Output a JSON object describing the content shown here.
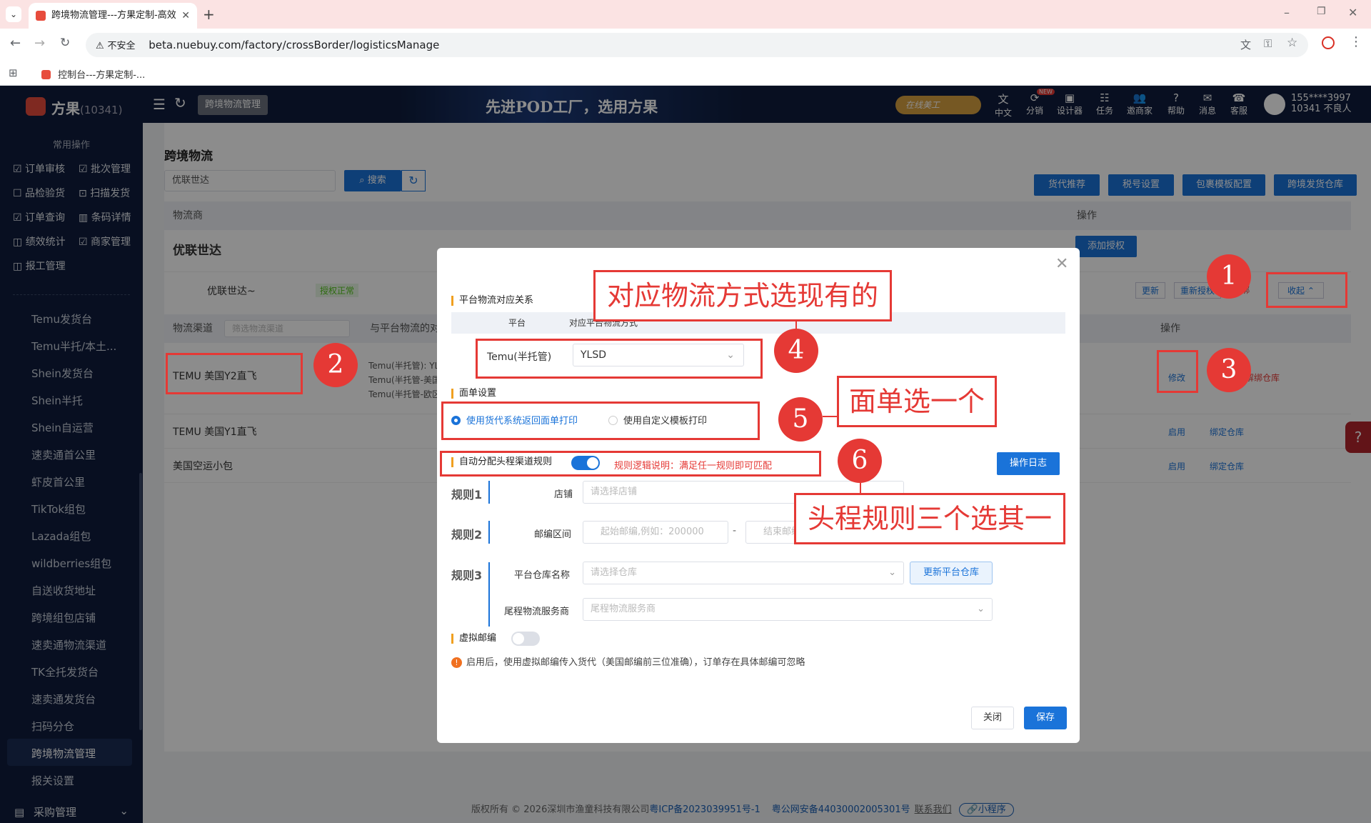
{
  "browser": {
    "tab_title": "跨境物流管理---方果定制-高效",
    "new_tab": "+",
    "url": "beta.nuebuy.com/factory/crossBorder/logisticsManage",
    "not_secure": "不安全",
    "bookmark": "控制台---方果定制-..."
  },
  "header": {
    "logo": "方果",
    "logo_id": "(10341)",
    "breadcrumb": "跨境物流管理",
    "slogan": "先进POD工厂，选用方果",
    "online_badge": "在线美工",
    "icons": [
      {
        "label": "中文",
        "icon": "translate-icon"
      },
      {
        "label": "分销",
        "icon": "share-icon",
        "badge": "NEW"
      },
      {
        "label": "设计器",
        "icon": "image-icon"
      },
      {
        "label": "任务",
        "icon": "task-icon"
      },
      {
        "label": "邀商家",
        "icon": "users-icon"
      },
      {
        "label": "帮助",
        "icon": "help-icon"
      },
      {
        "label": "消息",
        "icon": "message-icon"
      },
      {
        "label": "客服",
        "icon": "service-icon"
      }
    ],
    "user_phone": "155****3997",
    "user_name": "10341 不良人"
  },
  "sidebar": {
    "common_title": "常用操作",
    "quick": [
      [
        "订单审核",
        "批次管理"
      ],
      [
        "品检验货",
        "扫描发货"
      ],
      [
        "订单查询",
        "条码详情"
      ],
      [
        "绩效统计",
        "商家管理"
      ],
      [
        "报工管理",
        ""
      ]
    ],
    "items": [
      "Temu发货台",
      "Temu半托/本土...",
      "Shein发货台",
      "Shein半托",
      "Shein自运营",
      "速卖通首公里",
      "虾皮首公里",
      "TikTok组包",
      "Lazada组包",
      "wildberries组包",
      "自送收货地址",
      "跨境组包店铺",
      "速卖通物流渠道",
      "TK全托发货台",
      "速卖通发货台",
      "扫码分仓",
      "跨境物流管理",
      "报关设置"
    ],
    "active": "跨境物流管理",
    "bottom": "采购管理"
  },
  "page": {
    "title": "跨境物流",
    "search_value": "优联世达",
    "search_btn": "搜索",
    "right_btns": [
      "货代推荐",
      "税号设置",
      "包裹模板配置",
      "跨境发货仓库"
    ],
    "col_provider": "物流商",
    "col_ops": "操作",
    "provider": "优联世达",
    "add_auth": "添加授权",
    "account": "优联世达~",
    "auth_status": "授权正常",
    "account_ops": [
      "更新",
      "重新授权",
      "解绑",
      "收起"
    ],
    "channel_col": "物流渠道",
    "channel_filter": "筛选物流渠道",
    "mapping_col": "与平台物流的对",
    "channels": [
      {
        "name": "TEMU 美国Y2直飞",
        "mapping": [
          "Temu(半托管): YL",
          "Temu(半托管-美国",
          "Temu(半托管-欧区"
        ],
        "ops": [
          "修改",
          "解绑仓库"
        ]
      },
      {
        "name": "TEMU 美国Y1直飞",
        "mapping": [],
        "ops": [
          "启用",
          "绑定仓库"
        ]
      },
      {
        "name": "美国空运小包",
        "mapping": [],
        "ops": [
          "启用",
          "绑定仓库"
        ]
      }
    ],
    "footer": "版权所有 © 2026深圳市渔童科技有限公司",
    "footer_icp": "粤ICP备2023039951号-1",
    "footer_police": "粤公网安备44030002005301号",
    "footer_contact": "联系我们",
    "footer_mini": "小程序"
  },
  "modal": {
    "sec_mapping": "平台物流对应关系",
    "col_platform": "平台",
    "col_method": "对应平台物流方式",
    "platform": "Temu(半托管)",
    "method": "YLSD",
    "sec_label": "面单设置",
    "opt1": "使用货代系统返回面单打印",
    "opt2": "使用自定义模板打印",
    "sec_auto": "自动分配头程渠道规则",
    "auto_on": true,
    "rule_hint": "规则逻辑说明：满足任一规则即可匹配",
    "log_btn": "操作日志",
    "rule1": "规则1",
    "shop_label": "店铺",
    "shop_ph": "请选择店铺",
    "rule2": "规则2",
    "zip_label": "邮编区间",
    "zip_start_ph": "起始邮编,例如：200000",
    "zip_end_ph": "结束邮编,例如：299999",
    "dash": "-",
    "rule3": "规则3",
    "wh_label": "平台仓库名称",
    "wh_ph": "请选择仓库",
    "wh_btn": "更新平台仓库",
    "tail_label": "尾程物流服务商",
    "tail_ph": "尾程物流服务商",
    "virtual_zip": "虚拟邮编",
    "virtual_on": false,
    "virtual_hint": "启用后，使用虚拟邮编传入货代（美国邮编前三位准确），订单存在具体邮编可忽略",
    "close_btn": "关闭",
    "save_btn": "保存"
  },
  "annotations": {
    "n1": "1",
    "n2": "2",
    "n3": "3",
    "n4": "4",
    "n5": "5",
    "n6": "6",
    "c4": "对应物流方式选现有的",
    "c5": "面单选一个",
    "c6": "头程规则三个选其一"
  },
  "colors": {
    "primary": "#1a73d9",
    "danger": "#e53935",
    "sidebar": "#0f1d3d"
  }
}
